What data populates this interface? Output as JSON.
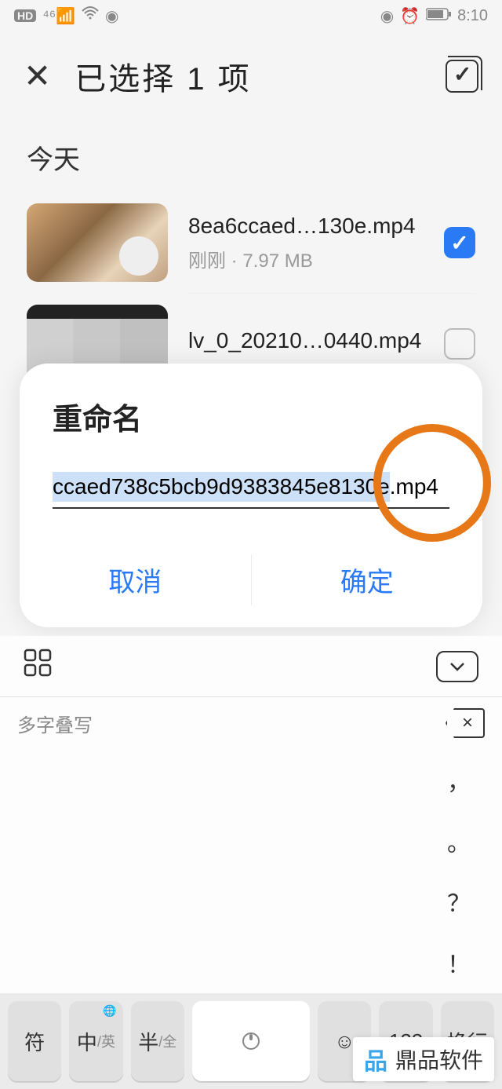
{
  "status": {
    "hd": "HD",
    "time": "8:10"
  },
  "header": {
    "title": "已选择 1 项"
  },
  "section": {
    "today": "今天"
  },
  "files": [
    {
      "name": "8ea6ccaed…130e.mp4",
      "meta": "刚刚 · 7.97 MB",
      "checked": true
    },
    {
      "name": "lv_0_20210…0440.mp4",
      "meta": "",
      "checked": false
    }
  ],
  "modal": {
    "title": "重命名",
    "value": "ccaed738c5bcb9d9383845e8130e.mp4",
    "cancel": "取消",
    "confirm": "确定"
  },
  "keyboard": {
    "suggest": "多字叠写",
    "punct": [
      "，",
      "。",
      "？",
      "！"
    ],
    "keys": {
      "sym": "符",
      "zh": "中",
      "zh_sub": "/英",
      "half": "半",
      "half_sub": "/全",
      "emoji": "☺",
      "num": "123",
      "enter": "换行"
    }
  },
  "watermark": "鼎品软件"
}
